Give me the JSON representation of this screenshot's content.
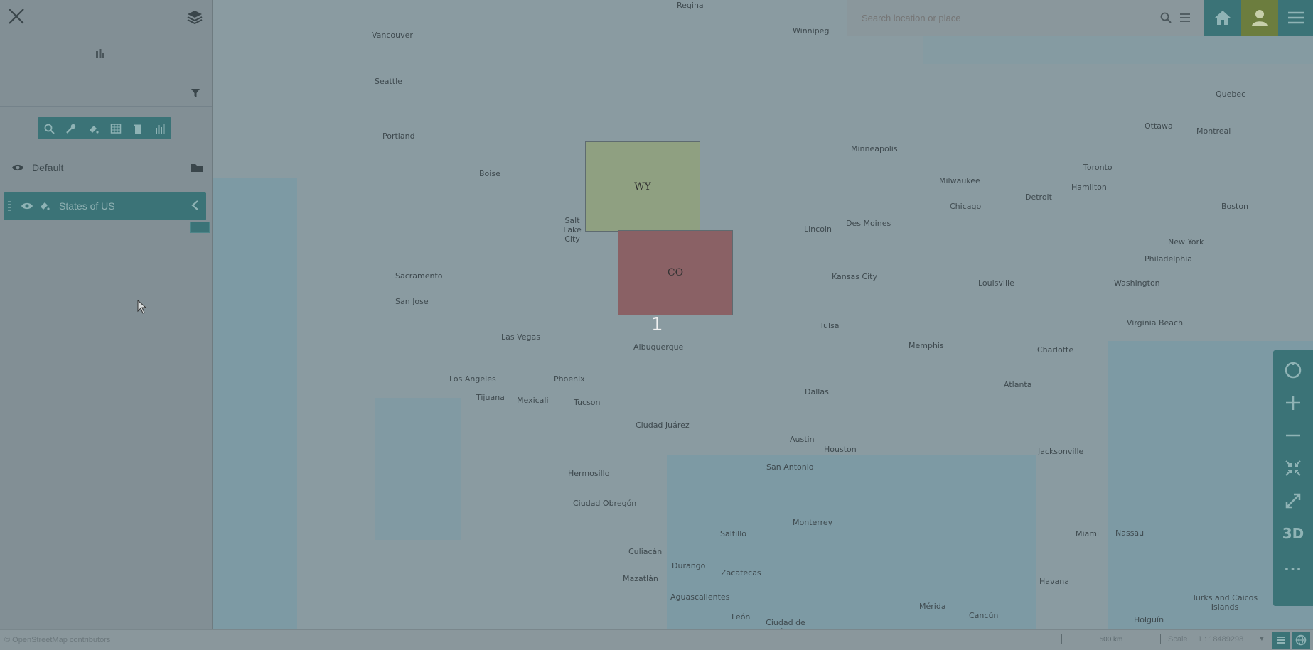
{
  "panel": {
    "search_placeholder": "",
    "layers": [
      {
        "name": "Default"
      },
      {
        "name": "States of US"
      }
    ]
  },
  "map": {
    "states": [
      {
        "label": "WY",
        "color": "#8fa081"
      },
      {
        "label": "CO",
        "color": "#8a6165"
      }
    ],
    "cluster_count": "1",
    "cities": [
      "Regina",
      "Winnipeg",
      "Vancouver",
      "Seattle",
      "Portland",
      "Boise",
      "Salt Lake City",
      "Sacramento",
      "San Jose",
      "Las Vegas",
      "Los Angeles",
      "Phoenix",
      "Tijuana",
      "Mexicali",
      "Tucson",
      "Albuquerque",
      "Minneapolis",
      "Milwaukee",
      "Chicago",
      "Detroit",
      "Toronto",
      "Hamilton",
      "Ottawa",
      "Montreal",
      "Quebec",
      "Boston",
      "New York",
      "Philadelphia",
      "Washington",
      "Des Moines",
      "Lincoln",
      "Kansas City",
      "Louisville",
      "Tulsa",
      "Memphis",
      "Charlotte",
      "Virginia Beach",
      "Atlanta",
      "Dallas",
      "Austin",
      "Houston",
      "San Antonio",
      "Jacksonville",
      "Ciudad Juárez",
      "Hermosillo",
      "Ciudad Obregón",
      "Saltillo",
      "Monterrey",
      "Culiacán",
      "Durango",
      "Mazatlán",
      "Zacatecas",
      "Aguascalientes",
      "León",
      "Ciudad de México",
      "Miami",
      "Nassau",
      "Havana",
      "Mérida",
      "Cancún",
      "Holguín",
      "Turks and Caicos Islands"
    ]
  },
  "topbar": {
    "search_placeholder": "Search location or place"
  },
  "nav": {
    "three_d_label": "3D",
    "more_label": "···"
  },
  "footer": {
    "attribution": "© OpenStreetMap contributors",
    "scalebar_label": "500 km",
    "scale_label": "Scale",
    "scale_value": "1 : 18489298"
  },
  "colors": {
    "accent": "#3b7377",
    "user": "#6c7d3e"
  }
}
